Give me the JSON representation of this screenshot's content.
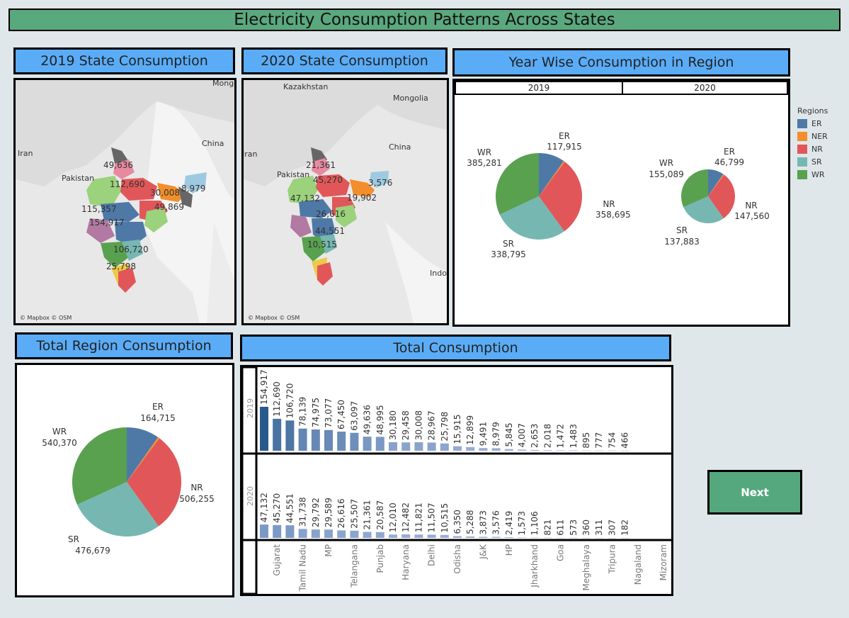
{
  "title": "Electricity Consumption Patterns Across States",
  "headers": {
    "map2019": "2019 State Consumption",
    "map2020": "2020 State Consumption",
    "yearwise": "Year Wise Consumption in Region",
    "total_region": "Total Region Consumption",
    "total": "Total Consumption"
  },
  "map_attribution": "© Mapbox © OSM",
  "map2019": {
    "place_labels": [
      "Iran",
      "Pakistan",
      "China",
      "Mongolia"
    ],
    "values": [
      "49,636",
      "112,690",
      "30,008",
      "8,979",
      "115,357",
      "49,869",
      "154,917",
      "106,720",
      "25,798"
    ]
  },
  "map2020": {
    "place_labels": [
      "Kazakhstan",
      "Mongolia",
      "China",
      "Pakistan",
      "Iran",
      "Indon"
    ],
    "values": [
      "21,361",
      "45,270",
      "47,132",
      "3,576",
      "19,902",
      "26,616",
      "44,551",
      "10,515"
    ]
  },
  "yearwise": {
    "tabs": [
      "2019",
      "2020"
    ],
    "legend_title": "Regions",
    "legend": [
      {
        "name": "ER",
        "color": "#4e79a7"
      },
      {
        "name": "NER",
        "color": "#f28e2b"
      },
      {
        "name": "NR",
        "color": "#e15759"
      },
      {
        "name": "SR",
        "color": "#76b7b2"
      },
      {
        "name": "WR",
        "color": "#59a14f"
      }
    ]
  },
  "next_label": "Next",
  "chart_data": [
    {
      "type": "pie",
      "title": "2019",
      "labels": [
        "ER",
        "NER",
        "NR",
        "SR",
        "WR"
      ],
      "values": [
        117915,
        6000,
        358695,
        338795,
        385281
      ],
      "value_labels": [
        "117,915",
        "",
        "358,695",
        "338,795",
        "385,281"
      ]
    },
    {
      "type": "pie",
      "title": "2020",
      "labels": [
        "ER",
        "NER",
        "NR",
        "SR",
        "WR"
      ],
      "values": [
        46799,
        3000,
        147560,
        137883,
        155089
      ],
      "value_labels": [
        "46,799",
        "",
        "147,560",
        "137,883",
        "155,089"
      ]
    },
    {
      "type": "pie",
      "title": "Total Region Consumption",
      "labels": [
        "ER",
        "NER",
        "NR",
        "SR",
        "WR"
      ],
      "values": [
        164715,
        9000,
        506255,
        476679,
        540370
      ],
      "value_labels": [
        "164,715",
        "",
        "506,255",
        "476,679",
        "540,370"
      ]
    },
    {
      "type": "bar",
      "title": "Total Consumption",
      "row_labels": [
        "2019",
        "2020"
      ],
      "category_labels": [
        "Gujarat",
        "Tamil Nadu",
        "MP",
        "Telangana",
        "Punjab",
        "Haryana",
        "Delhi",
        "Odisha",
        "J&K",
        "HP",
        "Jharkhand",
        "Goa",
        "Meghalaya",
        "Tripura",
        "Nagaland",
        "Mizoram"
      ],
      "series": [
        {
          "name": "2019",
          "values": [
            154917,
            112690,
            106720,
            78139,
            74975,
            73077,
            67450,
            63097,
            49636,
            48995,
            30180,
            29458,
            30008,
            28967,
            25798,
            15915,
            12899,
            9491,
            8979,
            5845,
            4007,
            2653,
            2018,
            1472,
            1483,
            895,
            777,
            754,
            466
          ],
          "labels": [
            "154,917",
            "112,690",
            "106,720",
            "78,139",
            "74,975",
            "73,077",
            "67,450",
            "63,097",
            "49,636",
            "48,995",
            "30,180",
            "29,458",
            "30,008",
            "28,967",
            "25,798",
            "15,915",
            "12,899",
            "9,491",
            "8,979",
            "5,845",
            "4,007",
            "2,653",
            "2,018",
            "1,472",
            "1,483",
            "895",
            "777",
            "754",
            "466"
          ]
        },
        {
          "name": "2020",
          "values": [
            47132,
            45270,
            44551,
            31738,
            29792,
            29589,
            26616,
            25507,
            21361,
            20587,
            12010,
            12482,
            11821,
            11507,
            10515,
            6350,
            5288,
            3873,
            3576,
            2419,
            1573,
            1106,
            821,
            611,
            573,
            360,
            311,
            307,
            182
          ],
          "labels": [
            "47,132",
            "45,270",
            "44,551",
            "31,738",
            "29,792",
            "29,589",
            "26,616",
            "25,507",
            "21,361",
            "20,587",
            "12,010",
            "12,482",
            "11,821",
            "11,507",
            "10,515",
            "6,350",
            "5,288",
            "3,873",
            "3,576",
            "2,419",
            "1,573",
            "1,106",
            "821",
            "611",
            "573",
            "360",
            "311",
            "307",
            "182"
          ]
        }
      ]
    }
  ]
}
